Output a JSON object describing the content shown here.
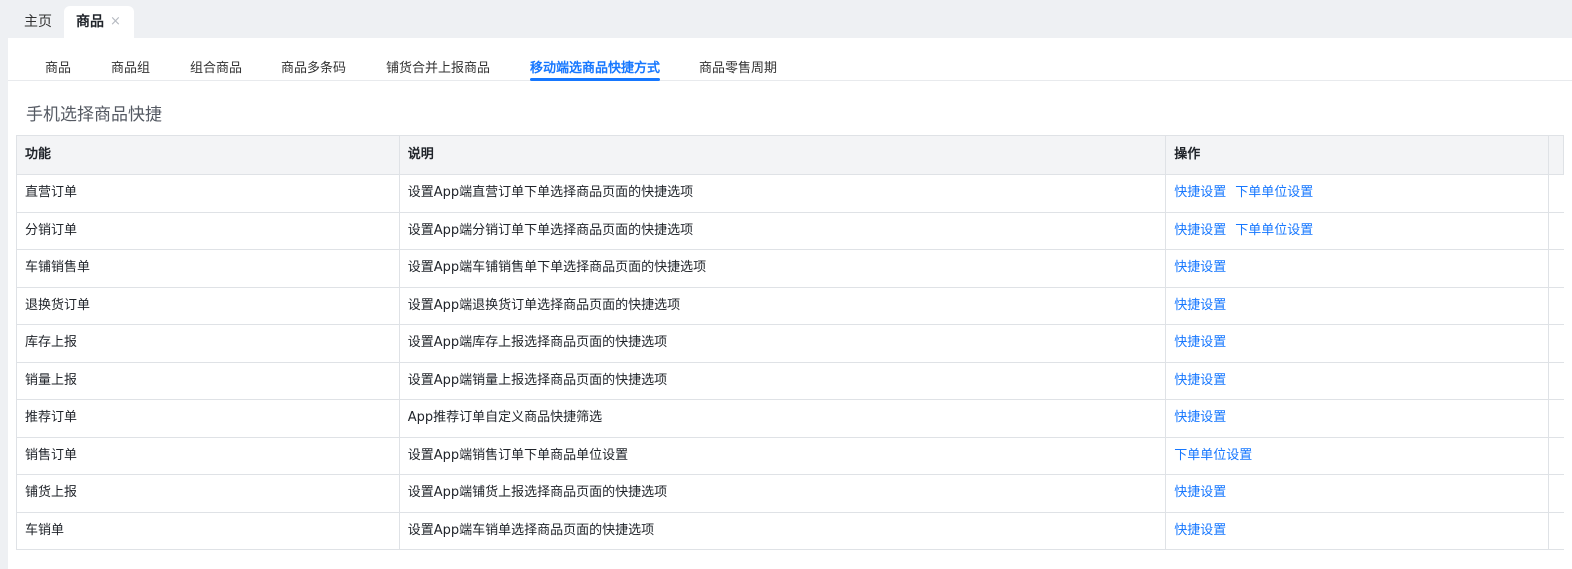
{
  "page_tabs": {
    "home_label": "主页",
    "active_label": "商品",
    "close_glyph": "×"
  },
  "sub_tabs": [
    {
      "label": "商品"
    },
    {
      "label": "商品组"
    },
    {
      "label": "组合商品"
    },
    {
      "label": "商品多条码"
    },
    {
      "label": "铺货合并上报商品"
    },
    {
      "label": "移动端选商品快捷方式"
    },
    {
      "label": "商品零售周期"
    }
  ],
  "active_sub_tab": 5,
  "section_title": "手机选择商品快捷",
  "table": {
    "headers": [
      "功能",
      "说明",
      "操作"
    ],
    "rows": [
      {
        "func": "直营订单",
        "desc": "设置App端直营订单下单选择商品页面的快捷选项",
        "actions": [
          "快捷设置",
          "下单单位设置"
        ]
      },
      {
        "func": "分销订单",
        "desc": "设置App端分销订单下单选择商品页面的快捷选项",
        "actions": [
          "快捷设置",
          "下单单位设置"
        ]
      },
      {
        "func": "车铺销售单",
        "desc": "设置App端车铺销售单下单选择商品页面的快捷选项",
        "actions": [
          "快捷设置"
        ]
      },
      {
        "func": "退换货订单",
        "desc": "设置App端退换货订单选择商品页面的快捷选项",
        "actions": [
          "快捷设置"
        ]
      },
      {
        "func": "库存上报",
        "desc": "设置App端库存上报选择商品页面的快捷选项",
        "actions": [
          "快捷设置"
        ]
      },
      {
        "func": "销量上报",
        "desc": "设置App端销量上报选择商品页面的快捷选项",
        "actions": [
          "快捷设置"
        ]
      },
      {
        "func": "推荐订单",
        "desc": "App推荐订单自定义商品快捷筛选",
        "actions": [
          "快捷设置"
        ]
      },
      {
        "func": "销售订单",
        "desc": "设置App端销售订单下单商品单位设置",
        "actions": [
          "下单单位设置"
        ]
      },
      {
        "func": "铺货上报",
        "desc": "设置App端铺货上报选择商品页面的快捷选项",
        "actions": [
          "快捷设置"
        ]
      },
      {
        "func": "车销单",
        "desc": "设置App端车销单选择商品页面的快捷选项",
        "actions": [
          "快捷设置"
        ]
      }
    ]
  },
  "colors": {
    "accent": "#1677ff",
    "header_bg": "#f3f4f6",
    "border": "#dfe2e6",
    "page_bg": "#eef0f3"
  }
}
